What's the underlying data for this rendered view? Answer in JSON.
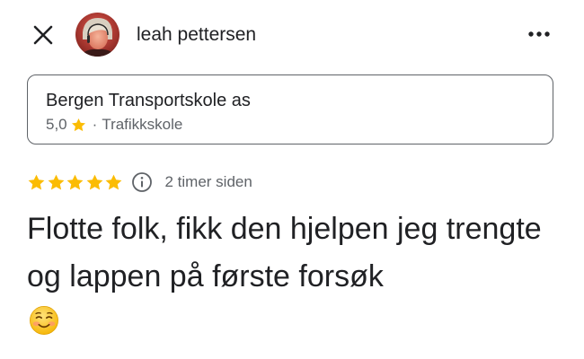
{
  "header": {
    "close_icon": "close-icon",
    "author_name": "leah pettersen",
    "more_icon": "more-horiz-icon"
  },
  "place": {
    "name": "Bergen Transportskole as",
    "rating": "5,0",
    "separator": "·",
    "category": "Trafikkskole",
    "star_color": "#fbbc04"
  },
  "review": {
    "stars": 5,
    "info_icon": "info-icon",
    "time": "2 timer siden",
    "text": "Flotte folk, fikk den hjelpen jeg trengte og lappen på første forsøk",
    "emoji": "☺️"
  },
  "colors": {
    "text_primary": "#202124",
    "text_secondary": "#5f6368",
    "star": "#fbbc04"
  }
}
